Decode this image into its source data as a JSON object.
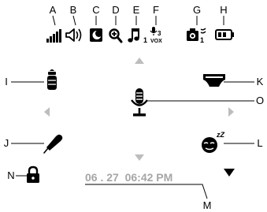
{
  "callouts": {
    "A": "A",
    "B": "B",
    "C": "C",
    "D": "D",
    "E": "E",
    "F": "F",
    "G": "G",
    "H": "H",
    "I": "I",
    "J": "J",
    "K": "K",
    "L": "L",
    "M": "M",
    "N": "N",
    "O": "O"
  },
  "status_bar": {
    "volume_icon": "speaker-volume-icon",
    "signal_icon": "signal-strength-icon",
    "night_icon": "night-light-icon",
    "zoom_icon": "zoom-icon",
    "music_icon": "lullaby-music-icon",
    "music_index": "1",
    "vox_icon": "vox-level-icon",
    "vox_level": "3",
    "vox_label": "VOX",
    "camera_icon": "camera-icon",
    "camera_index": "1",
    "battery_icon": "battery-icon"
  },
  "screen": {
    "feeding_icon": "feeding-bottle-icon",
    "medicine_icon": "medicine-dropper-icon",
    "lock_icon": "lock-icon",
    "diaper_icon": "diaper-icon",
    "sleep_icon": "sleep-face-icon",
    "sleep_text": "zZ",
    "talk_icon": "microphone-icon",
    "date_time": "06 . 27  06:42 PM"
  },
  "colors": {
    "icon": "#000000",
    "nav_arrow": "#bdbdbd",
    "date_text": "#a6a6a6"
  }
}
